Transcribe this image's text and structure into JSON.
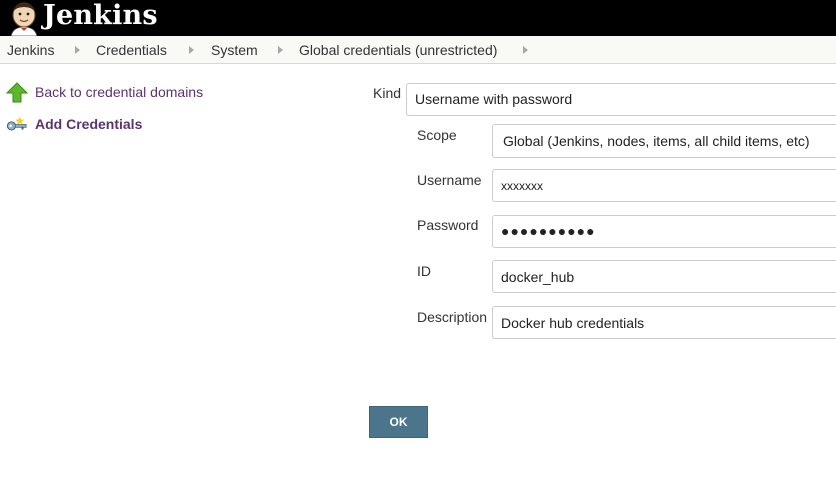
{
  "header": {
    "logo_text": "Jenkins"
  },
  "breadcrumb": {
    "items": [
      "Jenkins",
      "Credentials",
      "System",
      "Global credentials (unrestricted)"
    ]
  },
  "sidebar": {
    "back_label": "Back to credential domains",
    "add_label": "Add Credentials"
  },
  "form": {
    "kind_label": "Kind",
    "kind_value": "Username with password",
    "scope_label": "Scope",
    "scope_value": "Global (Jenkins, nodes, items, all child items, etc)",
    "username_label": "Username",
    "username_value": "xxxxxxx",
    "password_label": "Password",
    "password_value": "●●●●●●●●●●",
    "id_label": "ID",
    "id_value": "docker_hub",
    "description_label": "Description",
    "description_value": "Docker hub credentials",
    "ok_label": "OK"
  },
  "colors": {
    "header_bg": "#000000",
    "link": "#5a3371",
    "ok_button": "#4b758b",
    "breadcrumb_bg": "#f9f9f6"
  }
}
